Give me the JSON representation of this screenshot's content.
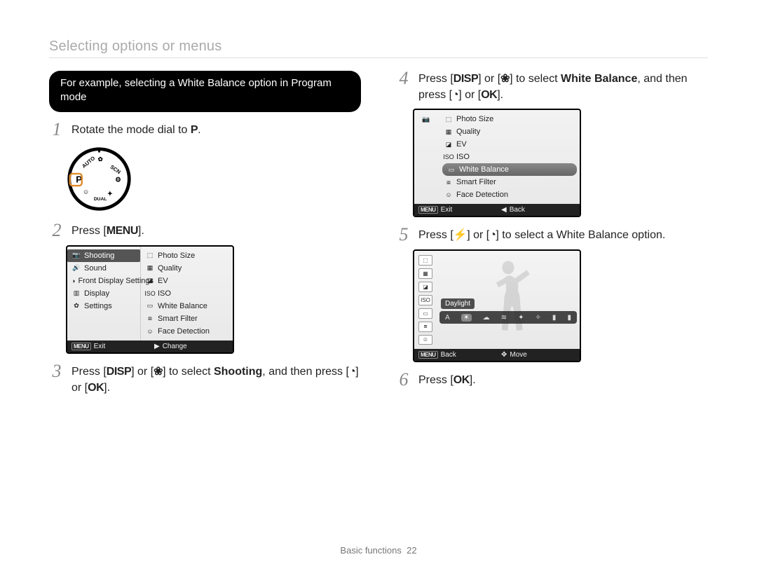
{
  "header": {
    "title": "Selecting options or menus"
  },
  "callout": {
    "text": "For example, selecting a White Balance option in Program mode"
  },
  "steps": {
    "s1": {
      "num": "1",
      "pre": "Rotate the mode dial to ",
      "mode": "P",
      "post": "."
    },
    "s2": {
      "num": "2",
      "pre": "Press [",
      "btn": "MENU",
      "post": "]."
    },
    "s3": {
      "num": "3",
      "a": "Press [",
      "disp": "DISP",
      "b": "] or [",
      "macroGlyph": "❀",
      "c": "] to select ",
      "bold": "Shooting",
      "d": ", and then press [",
      "timerGlyph": "◔",
      "e": "] or [",
      "ok": "OK",
      "f": "]."
    },
    "s4": {
      "num": "4",
      "a": "Press [",
      "disp": "DISP",
      "b": "] or [",
      "macroGlyph": "❀",
      "c": "] to select ",
      "bold": "White Balance",
      "d": ", and then press [",
      "timerGlyph": "◔",
      "e": "] or [",
      "ok": "OK",
      "f": "]."
    },
    "s5": {
      "num": "5",
      "a": "Press [",
      "flashGlyph": "⚡",
      "b": "] or [",
      "timerGlyph": "◔",
      "c": "] to select a White Balance option."
    },
    "s6": {
      "num": "6",
      "a": "Press [",
      "ok": "OK",
      "b": "]."
    }
  },
  "lcd1": {
    "left": [
      {
        "icon": "📷",
        "label": "Shooting",
        "sel": true
      },
      {
        "icon": "🔊",
        "label": "Sound"
      },
      {
        "icon": "◑",
        "label": "Front Display Settings"
      },
      {
        "icon": "▥",
        "label": "Display"
      },
      {
        "icon": "✿",
        "label": "Settings"
      }
    ],
    "right": [
      {
        "icon": "⬚",
        "label": "Photo Size"
      },
      {
        "icon": "▦",
        "label": "Quality"
      },
      {
        "icon": "◪",
        "label": "EV"
      },
      {
        "icon": "ISO",
        "label": "ISO"
      },
      {
        "icon": "▭",
        "label": "White Balance"
      },
      {
        "icon": "⧈",
        "label": "Smart Filter"
      },
      {
        "icon": "☺",
        "label": "Face Detection"
      }
    ],
    "foot": {
      "leftTag": "MENU",
      "left": "Exit",
      "rightGlyph": "▶",
      "right": "Change"
    }
  },
  "lcd2": {
    "sideIcon": "📷",
    "right": [
      {
        "icon": "⬚",
        "label": "Photo Size"
      },
      {
        "icon": "▦",
        "label": "Quality"
      },
      {
        "icon": "◪",
        "label": "EV"
      },
      {
        "icon": "ISO",
        "label": "ISO"
      },
      {
        "icon": "▭",
        "label": "White Balance",
        "pill": true
      },
      {
        "icon": "⧈",
        "label": "Smart Filter"
      },
      {
        "icon": "☺",
        "label": "Face Detection"
      }
    ],
    "foot": {
      "leftTag": "MENU",
      "left": "Exit",
      "rightGlyph": "◀",
      "right": "Back"
    }
  },
  "wb": {
    "sideIcons": [
      "⬚",
      "▦",
      "◪",
      "ISO",
      "▭",
      "⧈",
      "☺"
    ],
    "selectedLabel": "Daylight",
    "strip": [
      "A",
      "☀",
      "☁",
      "≋",
      "✦",
      "✧",
      "▮",
      "▮"
    ],
    "foot": {
      "leftTag": "MENU",
      "left": "Back",
      "rightGlyph": "✥",
      "right": "Move"
    }
  },
  "footer": {
    "section": "Basic functions",
    "page": "22"
  }
}
